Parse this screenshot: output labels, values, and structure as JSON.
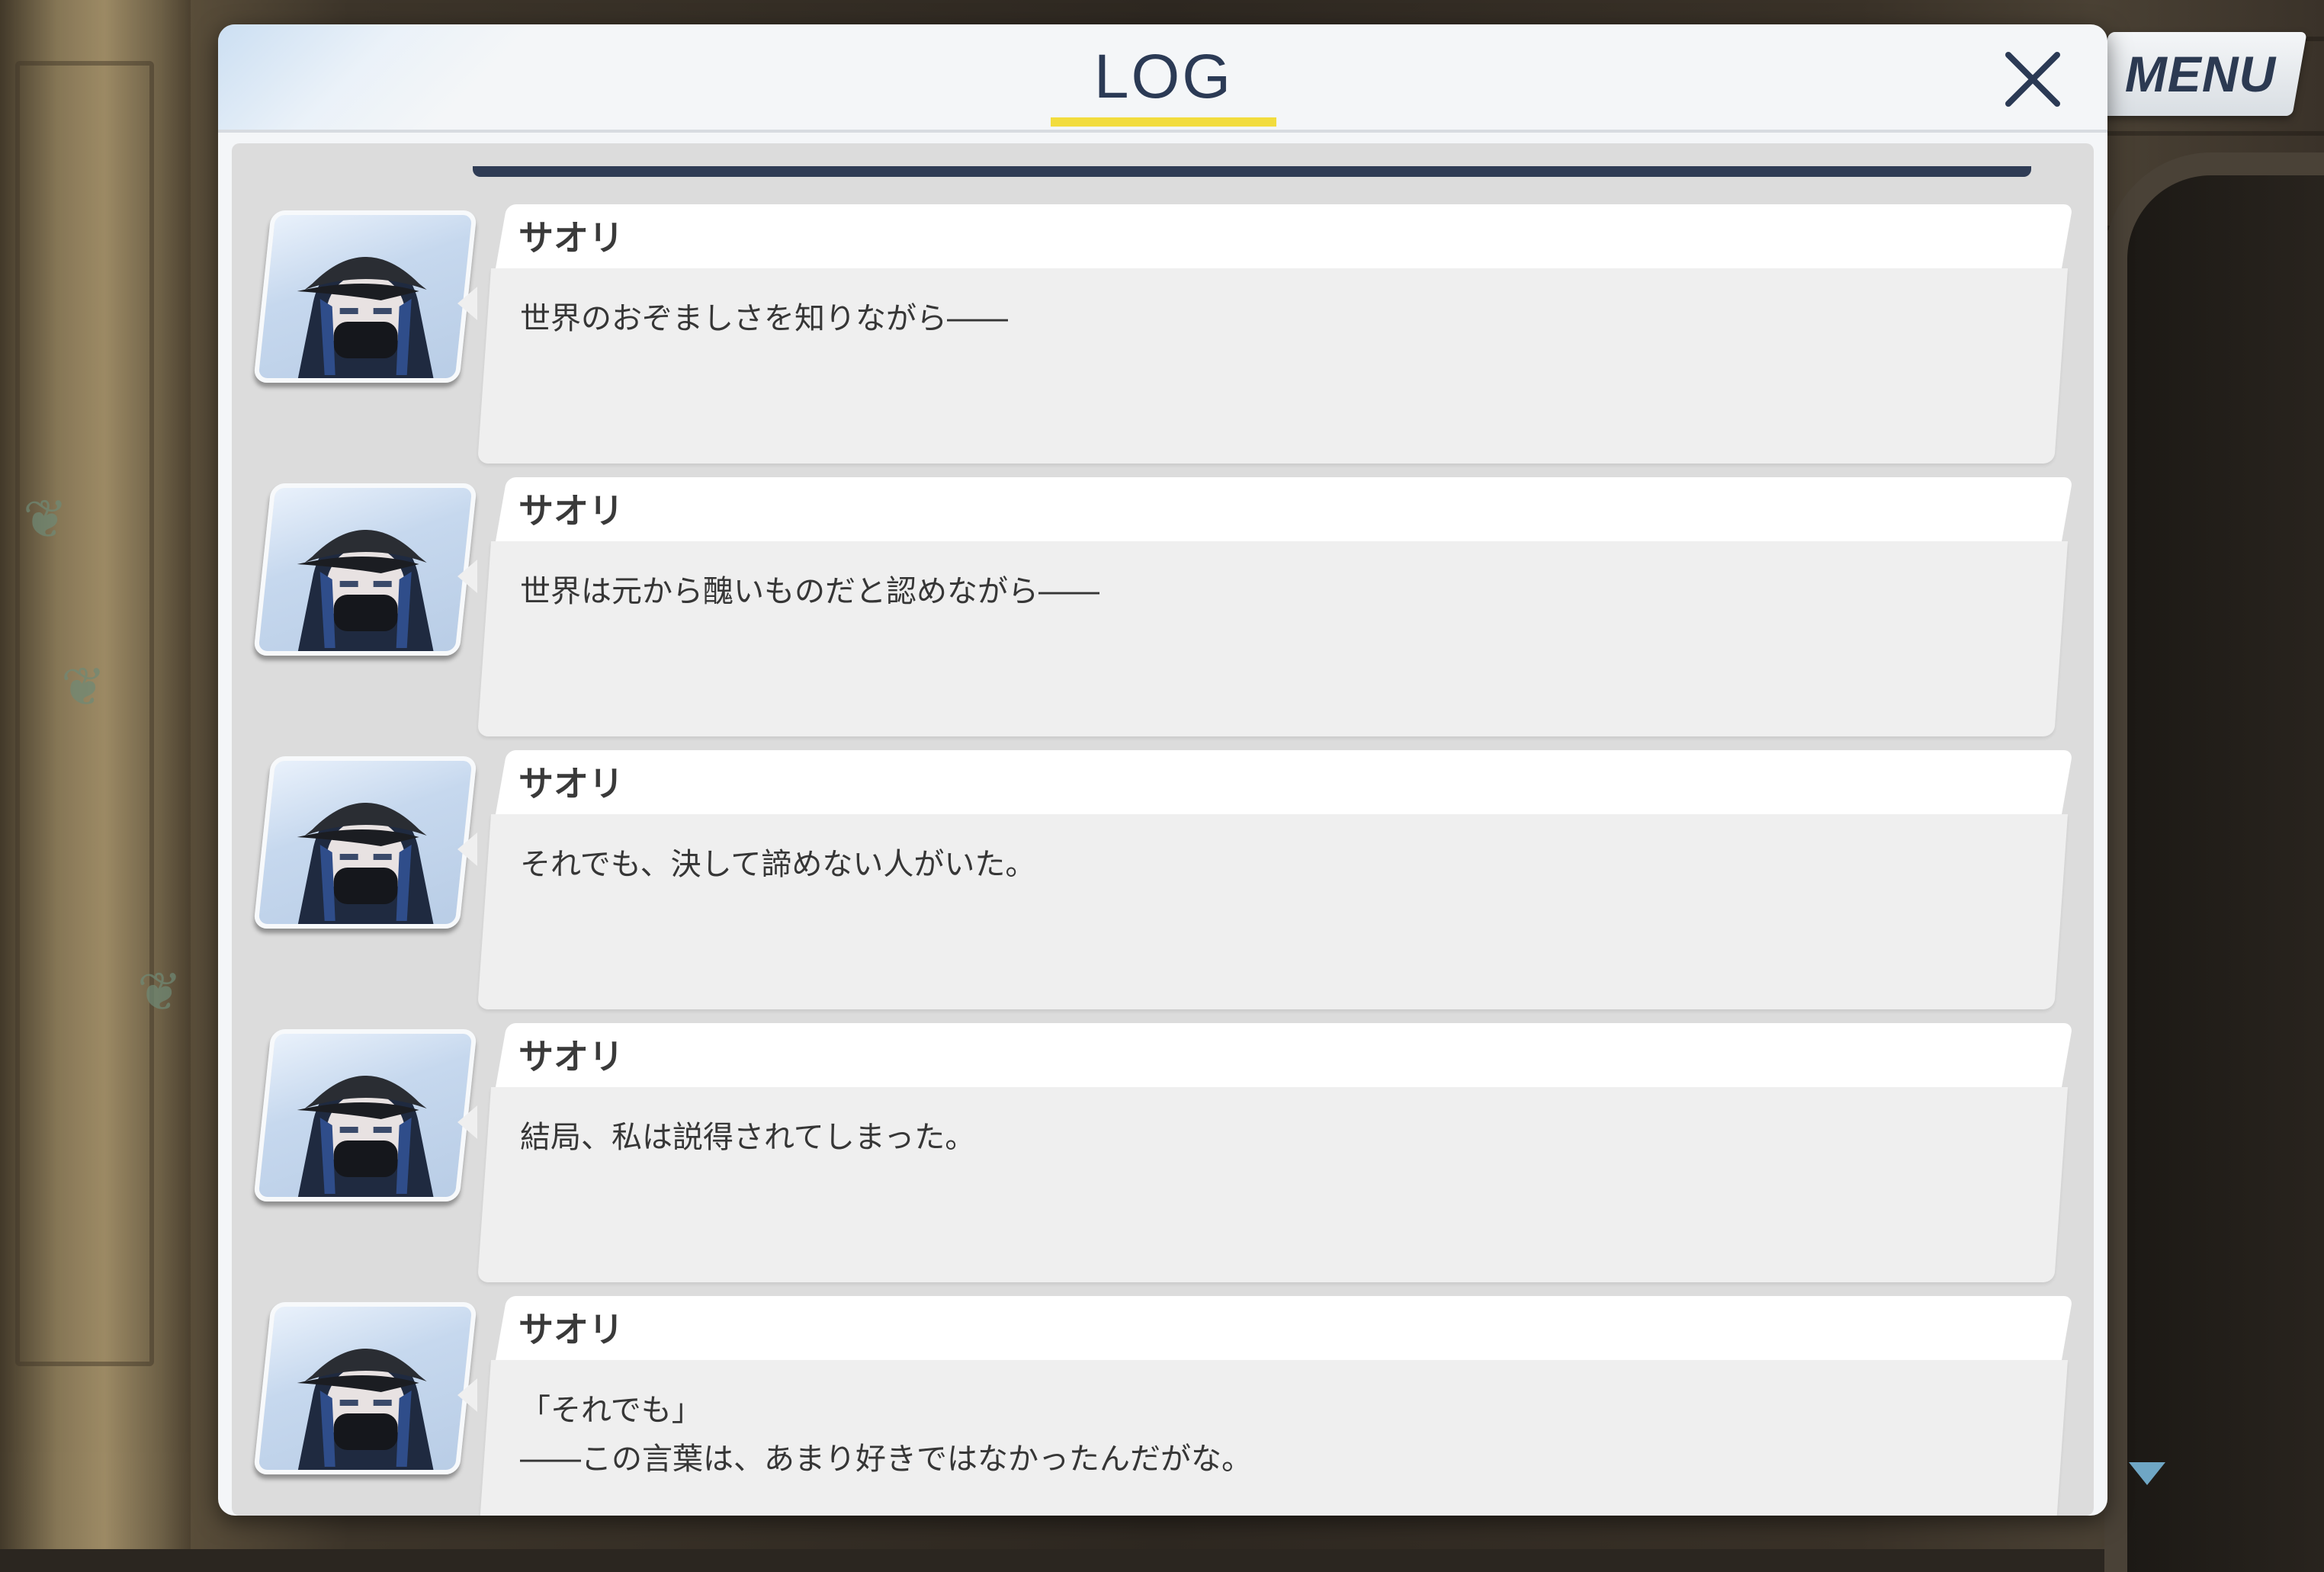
{
  "log_panel": {
    "title": "LOG",
    "close_icon": "close-x-icon"
  },
  "menu": {
    "label": "MENU"
  },
  "entries": [
    {
      "speaker": "サオリ",
      "avatar": "saori-portrait",
      "text": "世界のおぞましさを知りながら――"
    },
    {
      "speaker": "サオリ",
      "avatar": "saori-portrait",
      "text": "世界は元から醜いものだと認めながら――"
    },
    {
      "speaker": "サオリ",
      "avatar": "saori-portrait",
      "text": "それでも、決して諦めない人がいた。"
    },
    {
      "speaker": "サオリ",
      "avatar": "saori-portrait",
      "text": "結局、私は説得されてしまった。"
    },
    {
      "speaker": "サオリ",
      "avatar": "saori-portrait",
      "text": "「それでも」\n――この言葉は、あまり好きではなかったんだがな。"
    }
  ],
  "scroll_indicator": "scroll-down-arrow-icon",
  "colors": {
    "title_accent": "#f2dc3d",
    "title_text": "#2b3a55",
    "panel_bg": "#f4f6f8",
    "bubble_bg": "#efefef"
  }
}
